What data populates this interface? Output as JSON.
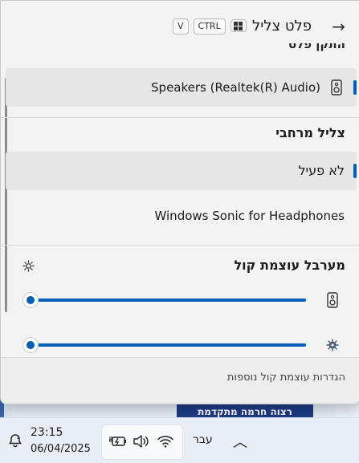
{
  "header": {
    "title": "פלט צליל",
    "shortcut_keys": [
      "CTRL",
      "V"
    ]
  },
  "cut_section_title": "התקן פלט",
  "devices": [
    {
      "label": "Speakers (Realtek(R) Audio)",
      "selected": true
    }
  ],
  "spatial": {
    "title": "צליל מרחבי",
    "options": [
      {
        "label": "לא פעיל",
        "selected": true
      },
      {
        "label": "Windows Sonic for Headphones",
        "selected": false
      }
    ]
  },
  "mixer": {
    "title": "מערבל עוצמת קול",
    "sliders": [
      {
        "name": "speakers",
        "value": 0
      },
      {
        "name": "system-sounds",
        "value": 0
      }
    ]
  },
  "footer": {
    "link": "הגדרות עוצמת קול נוספות"
  },
  "background": {
    "partial_text": "רצוה חרמה מתקדמת"
  },
  "taskbar": {
    "time": "23:15",
    "date": "06/04/2025",
    "language": "עבר"
  },
  "colors": {
    "accent": "#005fb8"
  }
}
